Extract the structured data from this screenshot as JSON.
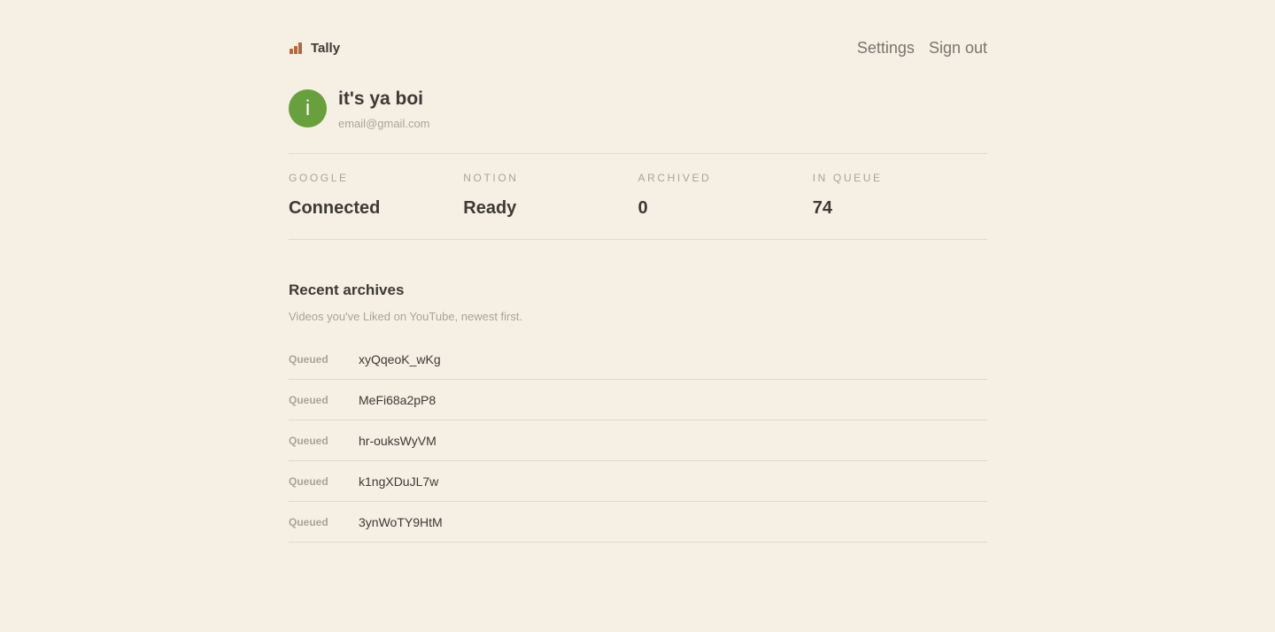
{
  "app": {
    "name": "Tally",
    "icon": "bar-chart-icon",
    "accent_color": "#b5683c"
  },
  "nav": {
    "settings": "Settings",
    "sign_out": "Sign out"
  },
  "profile": {
    "initial": "i",
    "name": "it's ya boi",
    "email": "email@gmail.com",
    "avatar_color": "#67a03c"
  },
  "stats": [
    {
      "label": "GOOGLE",
      "value": "Connected"
    },
    {
      "label": "NOTION",
      "value": "Ready"
    },
    {
      "label": "ARCHIVED",
      "value": "0"
    },
    {
      "label": "IN QUEUE",
      "value": "74"
    }
  ],
  "recent": {
    "title": "Recent archives",
    "subtitle": "Videos you've Liked on YouTube, newest first.",
    "items": [
      {
        "status": "Queued",
        "id": "xyQqeoK_wKg"
      },
      {
        "status": "Queued",
        "id": "MeFi68a2pP8"
      },
      {
        "status": "Queued",
        "id": "hr-ouksWyVM"
      },
      {
        "status": "Queued",
        "id": "k1ngXDuJL7w"
      },
      {
        "status": "Queued",
        "id": "3ynWoTY9HtM"
      }
    ]
  }
}
